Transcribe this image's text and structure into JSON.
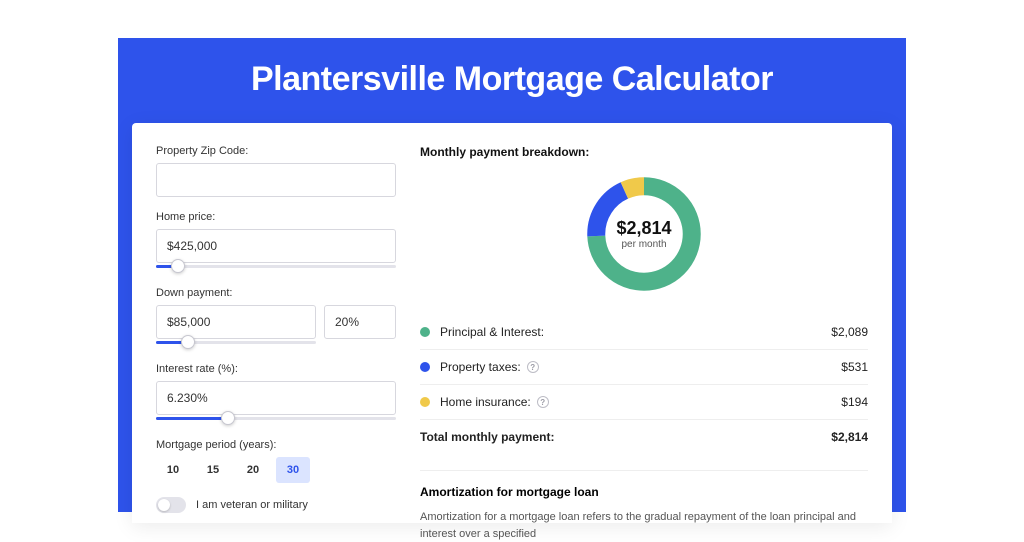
{
  "page_title": "Plantersville Mortgage Calculator",
  "form": {
    "zip_label": "Property Zip Code:",
    "zip_value": "",
    "home_price_label": "Home price:",
    "home_price_value": "$425,000",
    "home_price_slider_pct": 9,
    "down_label": "Down payment:",
    "down_value": "$85,000",
    "down_pct_value": "20%",
    "down_slider_pct": 20,
    "rate_label": "Interest rate (%):",
    "rate_value": "6.230%",
    "rate_slider_pct": 30,
    "period_label": "Mortgage period (years):",
    "periods": [
      "10",
      "15",
      "20",
      "30"
    ],
    "period_active": "30",
    "vet_label": "I am veteran or military"
  },
  "breakdown": {
    "title": "Monthly payment breakdown:",
    "total_display": "$2,814",
    "total_sub": "per month",
    "items": [
      {
        "key": "pi",
        "label": "Principal & Interest:",
        "value": "$2,089",
        "color": "green",
        "pct": 74.2,
        "info": false
      },
      {
        "key": "tax",
        "label": "Property taxes:",
        "value": "$531",
        "color": "blue",
        "pct": 18.9,
        "info": true
      },
      {
        "key": "ins",
        "label": "Home insurance:",
        "value": "$194",
        "color": "yellow",
        "pct": 6.9,
        "info": true
      }
    ],
    "total_label": "Total monthly payment:",
    "total_value": "$2,814"
  },
  "amort": {
    "title": "Amortization for mortgage loan",
    "text": "Amortization for a mortgage loan refers to the gradual repayment of the loan principal and interest over a specified"
  },
  "colors": {
    "brand": "#2e53eb",
    "green": "#4eb28a",
    "blue": "#2e53eb",
    "yellow": "#f0c94a"
  },
  "chart_data": {
    "type": "pie",
    "title": "Monthly payment breakdown",
    "categories": [
      "Principal & Interest",
      "Property taxes",
      "Home insurance"
    ],
    "values": [
      2089,
      531,
      194
    ],
    "colors": [
      "#4eb28a",
      "#2e53eb",
      "#f0c94a"
    ],
    "total": 2814,
    "center_label": "$2,814 per month"
  }
}
